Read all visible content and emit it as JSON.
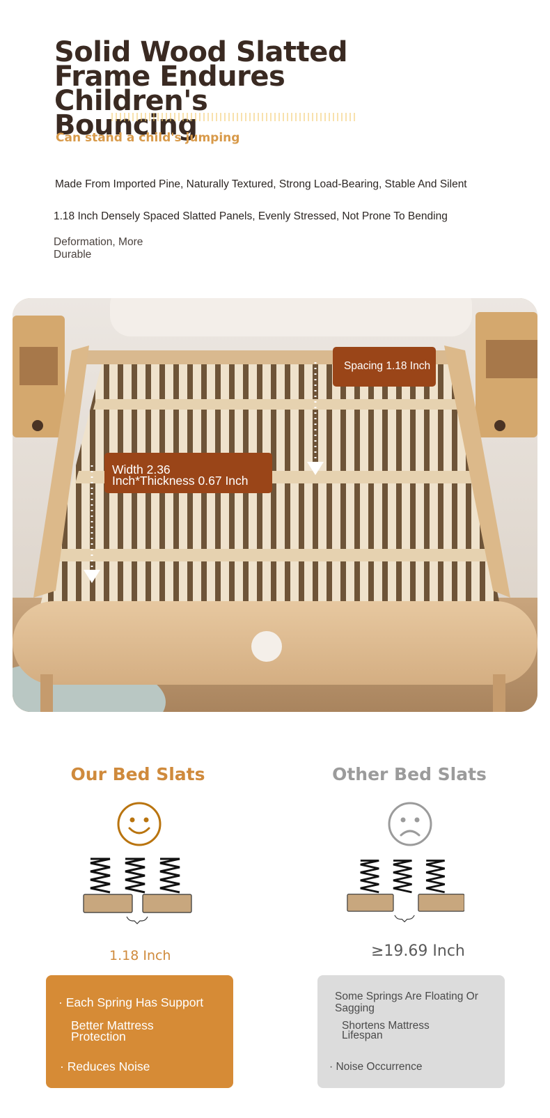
{
  "header": {
    "title": "Solid Wood Slatted\nFrame Endures\nChildren's Bouncing",
    "subtitle": "Can stand a child's jumping"
  },
  "description": {
    "line1": "Made From Imported Pine, Naturally Textured, Strong Load-Bearing, Stable And Silent",
    "line2": "1.18 Inch Densely Spaced Slatted Panels, Evenly Stressed, Not Prone To Bending",
    "line3": "Deformation, More\nDurable"
  },
  "photo": {
    "spacing_label": "Spacing 1.18 Inch",
    "width_label": "Width 2.36\nInch*Thickness 0.67 Inch"
  },
  "comparison": {
    "ours": {
      "title": "Our Bed Slats",
      "face_icon": "smiley-face-icon",
      "measure": "1.18 Inch",
      "points": {
        "p1": "· Each Spring Has Support",
        "p2": "Better Mattress\nProtection",
        "p3": "· Reduces Noise"
      },
      "color": "#d68b36"
    },
    "other": {
      "title": "Other Bed Slats",
      "face_icon": "sad-face-icon",
      "measure": "≥19.69 Inch",
      "points": {
        "p1": "Some Springs Are Floating Or\nSagging",
        "p2": "Shortens Mattress\nLifespan",
        "p3": "· Noise Occurrence"
      },
      "color": "#dcdcdc"
    }
  },
  "colors": {
    "title": "#3a2a22",
    "accent": "#cf8a3c",
    "tag_bg": "#9a4518",
    "slat_board": "#c8a77e"
  }
}
